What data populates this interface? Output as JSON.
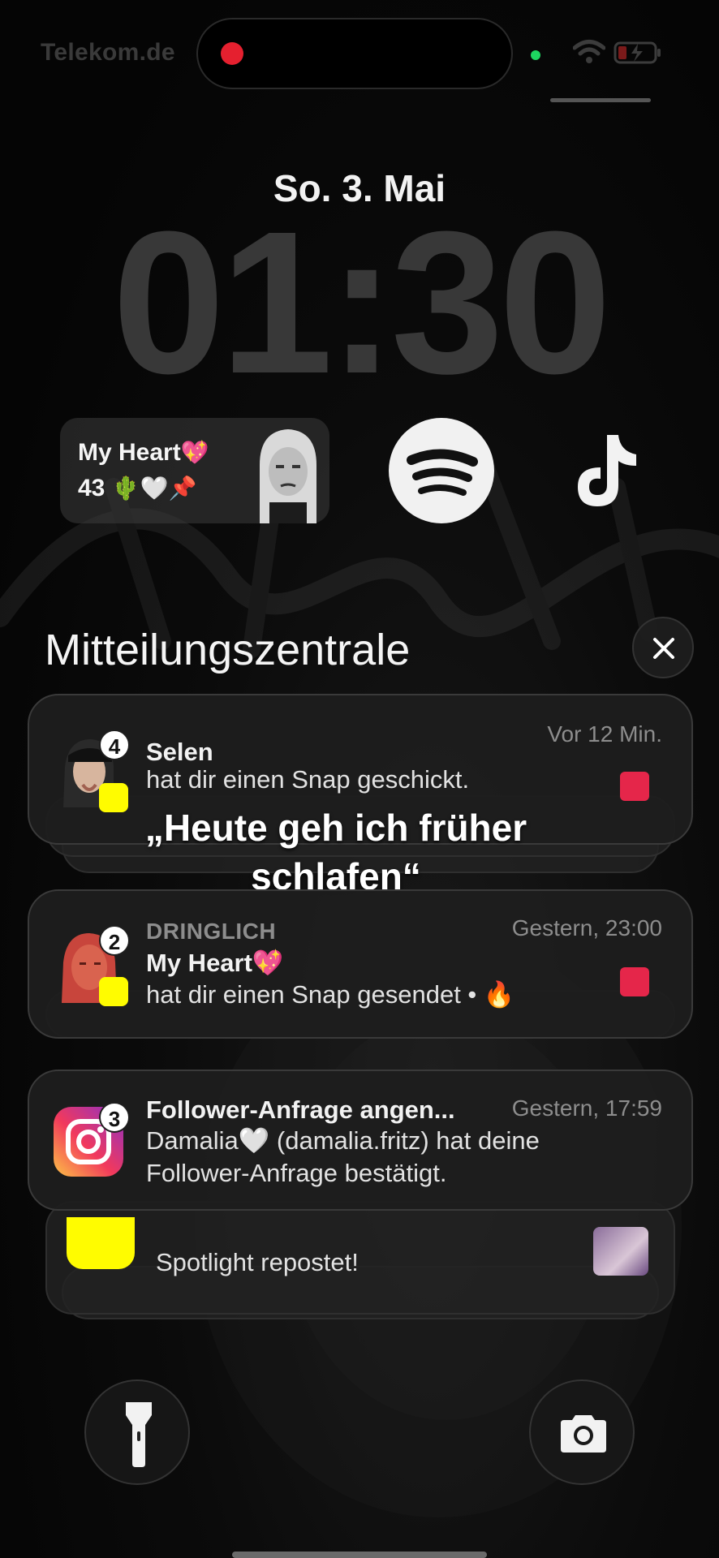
{
  "status_bar": {
    "carrier": "Telekom.de",
    "recording_dot_color": "#e5202f",
    "camera_indicator_color": "#1ed760",
    "icons": [
      "wifi-icon",
      "battery-charging-icon"
    ]
  },
  "lock_screen": {
    "date": "So. 3. Mai",
    "time": "01:30"
  },
  "widgets": {
    "streak": {
      "title": "My Heart",
      "title_emoji": "💖",
      "count": "43",
      "count_emojis": "🌵🤍📌",
      "avatar_icon": "bitmoji-avatar-icon"
    },
    "spotify": {
      "icon": "spotify-icon",
      "color": "#f1f1f1"
    },
    "tiktok": {
      "icon": "tiktok-icon"
    }
  },
  "notification_center": {
    "title": "Mitteilungszentrale",
    "close_icon": "close-icon"
  },
  "notifications": [
    {
      "app_icon": "bitmoji-avatar-icon",
      "sub_icon": "snapchat-icon",
      "badge": "4",
      "time": "Vor 12 Min.",
      "title": "Selen",
      "body": "hat dir einen Snap geschickt.",
      "snap_color": "#e5264a"
    },
    {
      "app_icon": "bitmoji-avatar-icon",
      "sub_icon": "snapchat-icon",
      "badge": "2",
      "label": "DRINGLICH",
      "time": "Gestern, 23:00",
      "title": "My Heart💖",
      "body": "hat dir einen Snap gesendet • 🔥",
      "snap_color": "#e5264a"
    },
    {
      "app_icon": "instagram-icon",
      "badge": "3",
      "time": "Gestern, 17:59",
      "title": "Follower-Anfrage angen...",
      "body_line1": "Damalia🤍 (damalia.fritz) hat deine",
      "body_line2": "Follower-Anfrage bestätigt."
    },
    {
      "app_icon": "snapchat-icon",
      "body": "Spotlight repostet!"
    }
  ],
  "caption": {
    "line1": "„Heute geh ich früher",
    "line2": "schlafen“"
  },
  "quick_actions": {
    "left_icon": "flashlight-icon",
    "right_icon": "camera-icon"
  }
}
